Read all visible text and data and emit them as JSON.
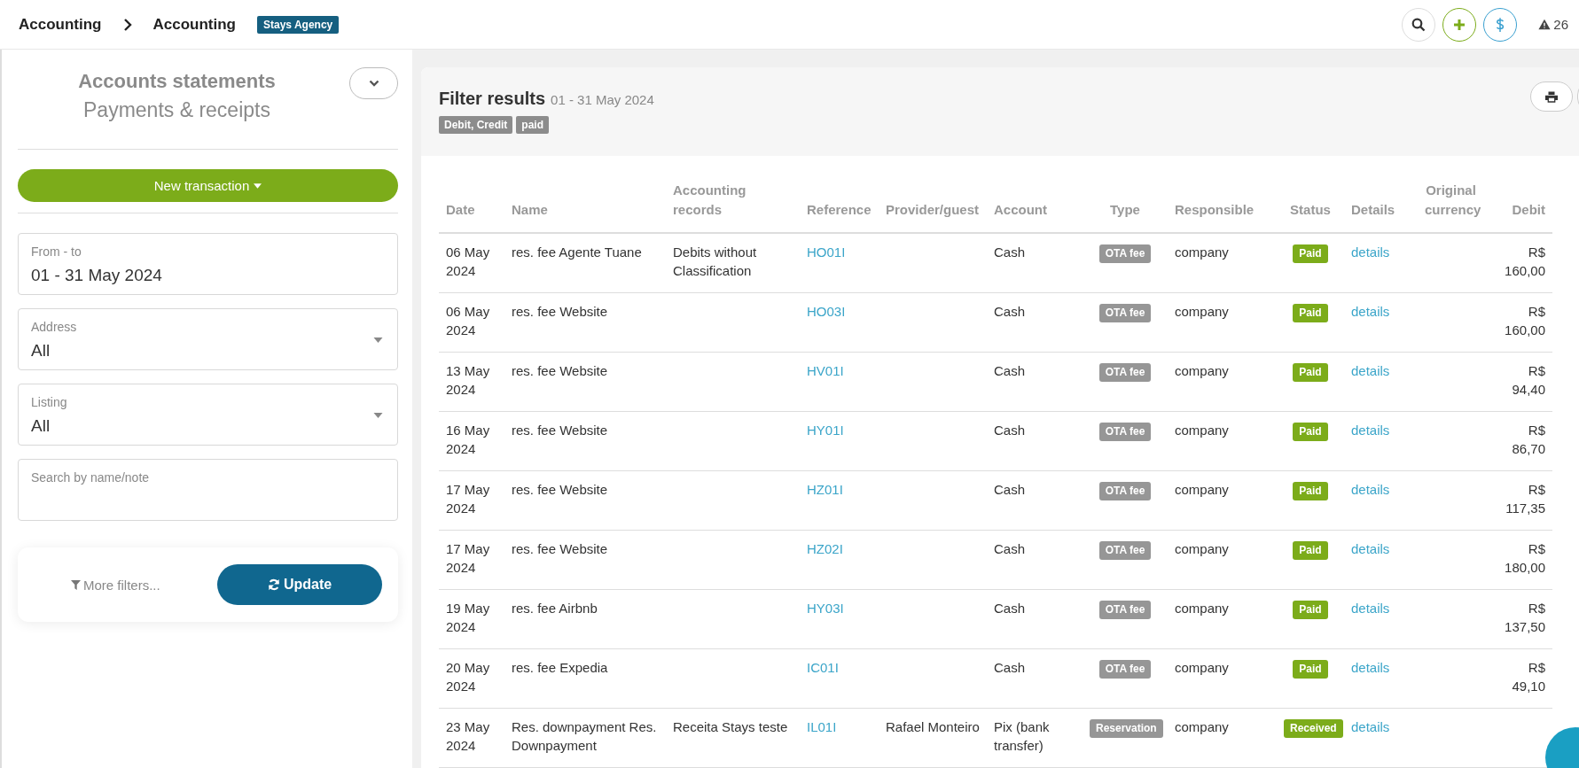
{
  "breadcrumb": [
    {
      "label": "Accounting"
    },
    {
      "label": "Accounting"
    }
  ],
  "agency_badge": "Stays Agency",
  "alerts": {
    "count": "26"
  },
  "sidebar": {
    "title": "Accounts statements",
    "subtitle": "Payments & receipts",
    "new_transaction": "New transaction",
    "fields": [
      {
        "kind": "date",
        "label": "From - to",
        "value": "01 - 31 May 2024"
      },
      {
        "kind": "select",
        "label": "Address",
        "value": "All"
      },
      {
        "kind": "select",
        "label": "Listing",
        "value": "All"
      },
      {
        "kind": "text",
        "placeholder": "Search by name/note"
      }
    ],
    "more_filters": "More filters...",
    "update": "Update"
  },
  "results": {
    "title": "Filter results",
    "period": "01 - 31 May 2024",
    "tags": [
      "Debit, Credit",
      "paid"
    ]
  },
  "table": {
    "columns": [
      "Date",
      "Name",
      "Accounting records",
      "Reference",
      "Provider/guest",
      "Account",
      "Type",
      "Responsible",
      "Status",
      "Details",
      "Original currency",
      "Debit"
    ],
    "rows": [
      {
        "date": "06 May 2024",
        "name": "res. fee Agente Tuane",
        "records": "Debits without Classification",
        "reference": "HO01I",
        "provider": "",
        "account": "Cash",
        "type": "OTA fee",
        "responsible": "company",
        "status": "Paid",
        "details": "details",
        "debit": "R$ 160,00"
      },
      {
        "date": "06 May 2024",
        "name": "res. fee Website",
        "records": "",
        "reference": "HO03I",
        "provider": "",
        "account": "Cash",
        "type": "OTA fee",
        "responsible": "company",
        "status": "Paid",
        "details": "details",
        "debit": "R$ 160,00"
      },
      {
        "date": "13 May 2024",
        "name": "res. fee Website",
        "records": "",
        "reference": "HV01I",
        "provider": "",
        "account": "Cash",
        "type": "OTA fee",
        "responsible": "company",
        "status": "Paid",
        "details": "details",
        "debit": "R$ 94,40"
      },
      {
        "date": "16 May 2024",
        "name": "res. fee Website",
        "records": "",
        "reference": "HY01I",
        "provider": "",
        "account": "Cash",
        "type": "OTA fee",
        "responsible": "company",
        "status": "Paid",
        "details": "details",
        "debit": "R$ 86,70"
      },
      {
        "date": "17 May 2024",
        "name": "res. fee Website",
        "records": "",
        "reference": "HZ01I",
        "provider": "",
        "account": "Cash",
        "type": "OTA fee",
        "responsible": "company",
        "status": "Paid",
        "details": "details",
        "debit": "R$ 117,35"
      },
      {
        "date": "17 May 2024",
        "name": "res. fee Website",
        "records": "",
        "reference": "HZ02I",
        "provider": "",
        "account": "Cash",
        "type": "OTA fee",
        "responsible": "company",
        "status": "Paid",
        "details": "details",
        "debit": "R$ 180,00"
      },
      {
        "date": "19 May 2024",
        "name": "res. fee Airbnb",
        "records": "",
        "reference": "HY03I",
        "provider": "",
        "account": "Cash",
        "type": "OTA fee",
        "responsible": "company",
        "status": "Paid",
        "details": "details",
        "debit": "R$ 137,50"
      },
      {
        "date": "20 May 2024",
        "name": "res. fee Expedia",
        "records": "",
        "reference": "IC01I",
        "provider": "",
        "account": "Cash",
        "type": "OTA fee",
        "responsible": "company",
        "status": "Paid",
        "details": "details",
        "debit": "R$ 49,10"
      },
      {
        "date": "23 May 2024",
        "name": "Res. downpayment Res. Downpayment",
        "records": "Receita Stays teste",
        "reference": "IL01I",
        "provider": "Rafael Monteiro",
        "account": "Pix (bank transfer)",
        "type": "Reservation",
        "responsible": "company",
        "status": "Received",
        "details": "details",
        "debit": ""
      }
    ]
  }
}
